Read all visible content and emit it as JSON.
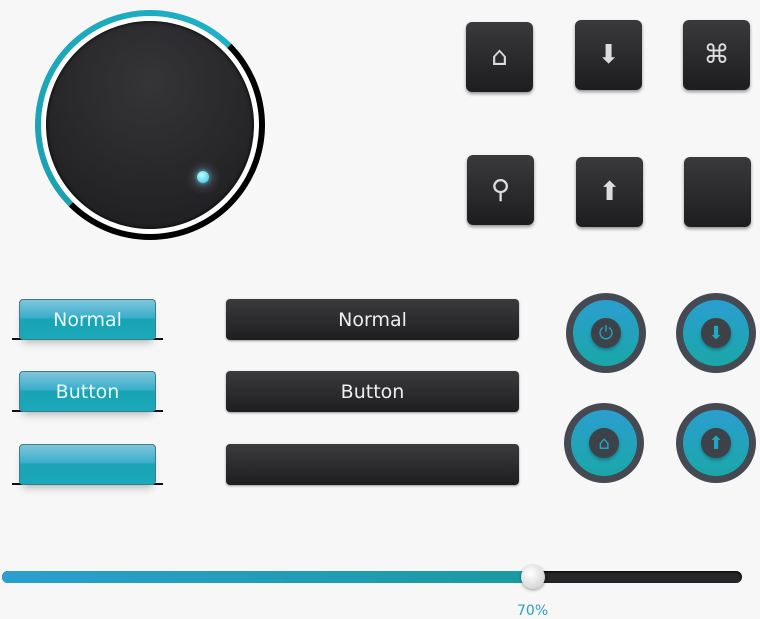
{
  "knob": {
    "accent": "#1fb0c8"
  },
  "icon_buttons": [
    {
      "icon": "home-icon",
      "glyph": "⌂"
    },
    {
      "icon": "arrow-down-icon",
      "glyph": "⬇"
    },
    {
      "icon": "command-icon",
      "glyph": "⌘"
    },
    {
      "icon": "search-icon",
      "glyph": "⚲"
    },
    {
      "icon": "arrow-up-icon",
      "glyph": "⬆"
    },
    {
      "icon": "blank",
      "glyph": ""
    }
  ],
  "teal_buttons": [
    "Normal",
    "Button",
    ""
  ],
  "dark_buttons": [
    "Normal",
    "Button",
    ""
  ],
  "round_buttons": [
    {
      "icon": "power-icon",
      "glyph": "⏻"
    },
    {
      "icon": "arrow-down-icon",
      "glyph": "⬇"
    },
    {
      "icon": "home-icon",
      "glyph": "⌂"
    },
    {
      "icon": "arrow-up-icon",
      "glyph": "⬆"
    }
  ],
  "slider": {
    "value": 70,
    "label": "70%"
  },
  "colors": {
    "teal": "#1aa9bb",
    "dark": "#1e1e20",
    "accent": "#2a9fd0"
  }
}
